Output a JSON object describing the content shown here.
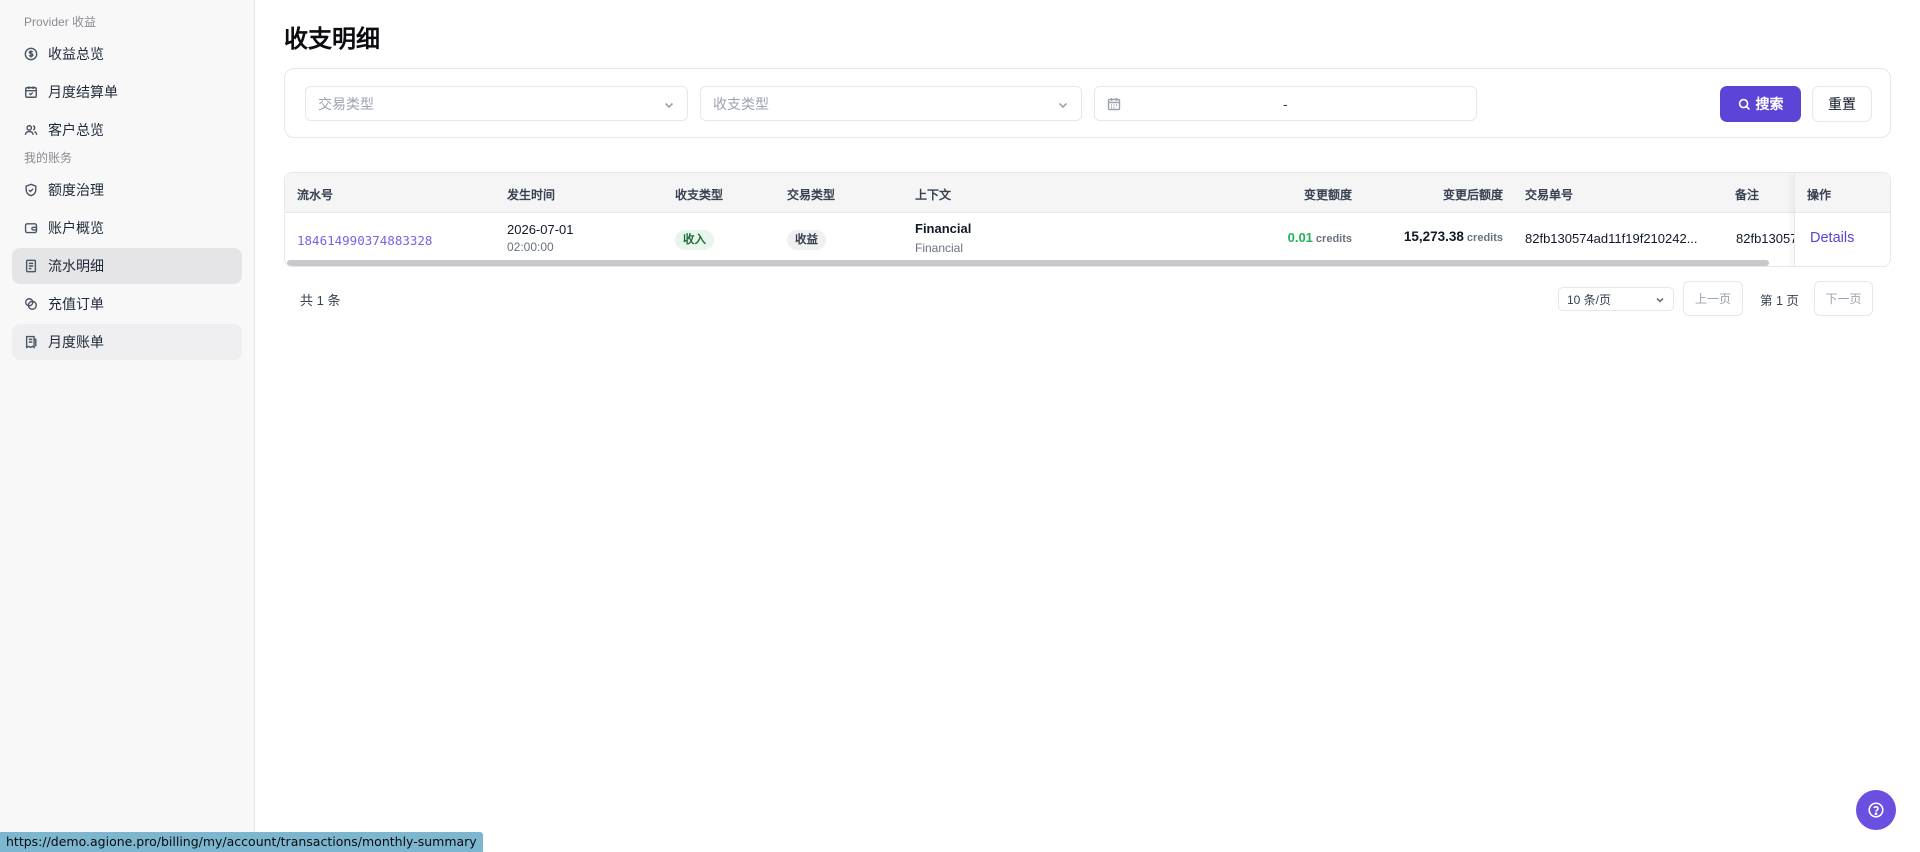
{
  "sidebar": {
    "section1": "Provider 收益",
    "items1": [
      {
        "label": "收益总览",
        "icon": "dollar-circle-icon"
      },
      {
        "label": "月度结算单",
        "icon": "calendar-icon"
      },
      {
        "label": "客户总览",
        "icon": "users-icon"
      }
    ],
    "section2": "我的账务",
    "items2": [
      {
        "label": "额度治理",
        "icon": "shield-icon"
      },
      {
        "label": "账户概览",
        "icon": "wallet-icon"
      },
      {
        "label": "流水明细",
        "icon": "document-icon",
        "active": true
      },
      {
        "label": "充值订单",
        "icon": "coins-icon"
      },
      {
        "label": "月度账单",
        "icon": "receipt-icon",
        "hover": true
      }
    ]
  },
  "page": {
    "title": "收支明细"
  },
  "filters": {
    "trade_type_placeholder": "交易类型",
    "income_type_placeholder": "收支类型",
    "date_separator": "-",
    "search_label": "搜索",
    "reset_label": "重置"
  },
  "table": {
    "headers": {
      "serial": "流水号",
      "time": "发生时间",
      "io_type": "收支类型",
      "trade_type": "交易类型",
      "context": "上下文",
      "change": "变更额度",
      "after": "变更后额度",
      "order": "交易单号",
      "remark": "备注",
      "actions": "操作"
    },
    "rows": [
      {
        "serial": "184614990374883328",
        "date": "2026-07-01",
        "time": "02:00:00",
        "io_type": "收入",
        "trade_type": "收益",
        "context_title": "Financial",
        "context_sub": "Financial",
        "change": "0.01",
        "change_unit": "credits",
        "after": "15,273.38",
        "after_unit": "credits",
        "order": "82fb130574ad11f19f210242...",
        "remark": "82fb13057",
        "action": "Details"
      }
    ]
  },
  "pagination": {
    "total": "共 1 条",
    "page_size": "10 条/页",
    "prev": "上一页",
    "current": "第 1 页",
    "next": "下一页"
  },
  "status_bar": {
    "url": "https://demo.agione.pro/billing/my/account/transactions/monthly-summary"
  },
  "colors": {
    "accent": "#5b44d6",
    "positive": "#22b35a",
    "link": "#7b61e8"
  }
}
